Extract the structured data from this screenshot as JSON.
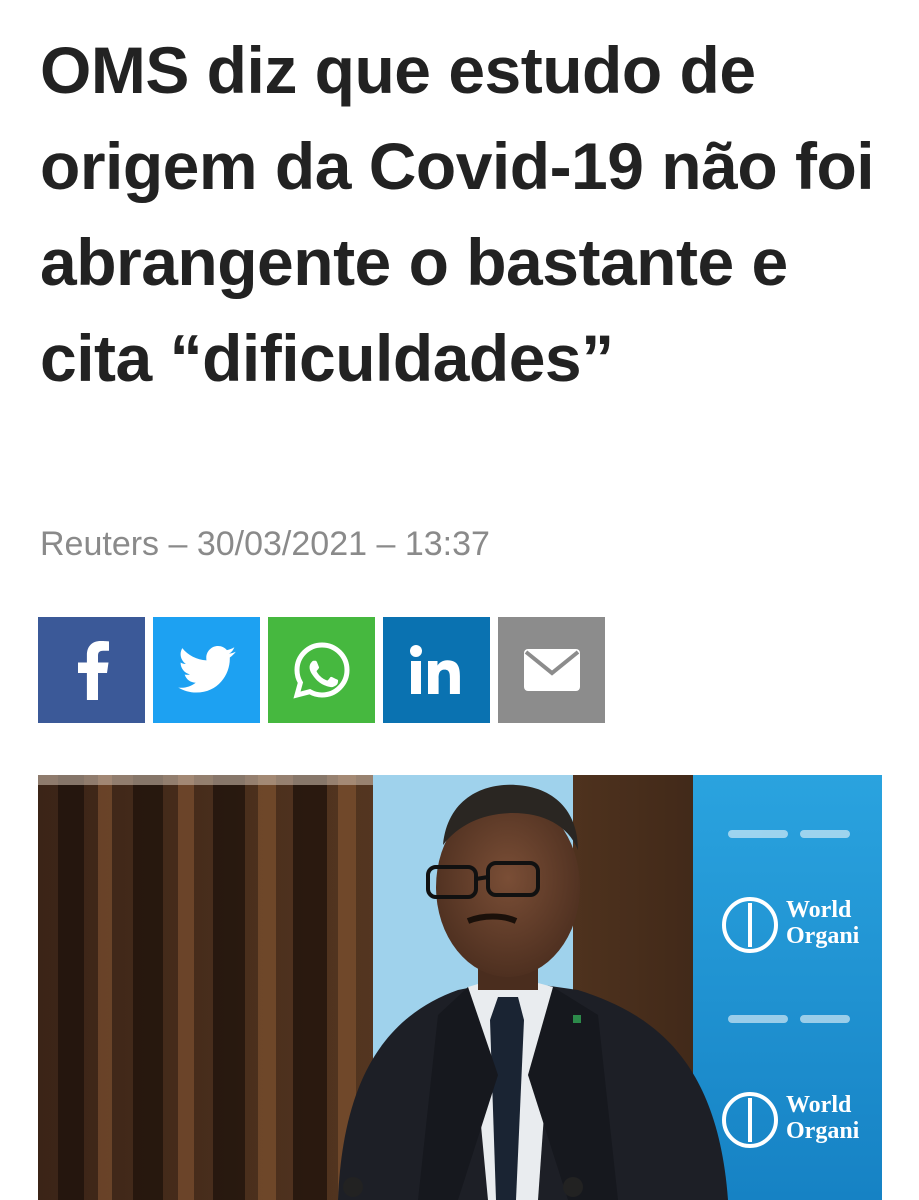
{
  "article": {
    "headline": "OMS diz que estudo de origem da Covid-19 não foi abrangente o bastante e cita “dificuldades”",
    "meta": "Reuters – 30/03/2021 – 13:37"
  },
  "share": {
    "buttons": [
      {
        "network": "facebook",
        "icon": "facebook-icon",
        "color": "#3b5998"
      },
      {
        "network": "twitter",
        "icon": "twitter-icon",
        "color": "#1da1f2"
      },
      {
        "network": "whatsapp",
        "icon": "whatsapp-icon",
        "color": "#46b83f"
      },
      {
        "network": "linkedin",
        "icon": "linkedin-icon",
        "color": "#0a72b1",
        "glyph": "in"
      },
      {
        "network": "email",
        "icon": "envelope-icon",
        "color": "#8c8c8c"
      }
    ]
  },
  "photo": {
    "backdrop_text_1": "World",
    "backdrop_text_2": "Organi",
    "backdrop_text_3": "World",
    "backdrop_text_4": "Organi"
  },
  "colors": {
    "headline": "#222222",
    "meta": "#8a8a8a",
    "who_blue": "#1f97d4"
  }
}
